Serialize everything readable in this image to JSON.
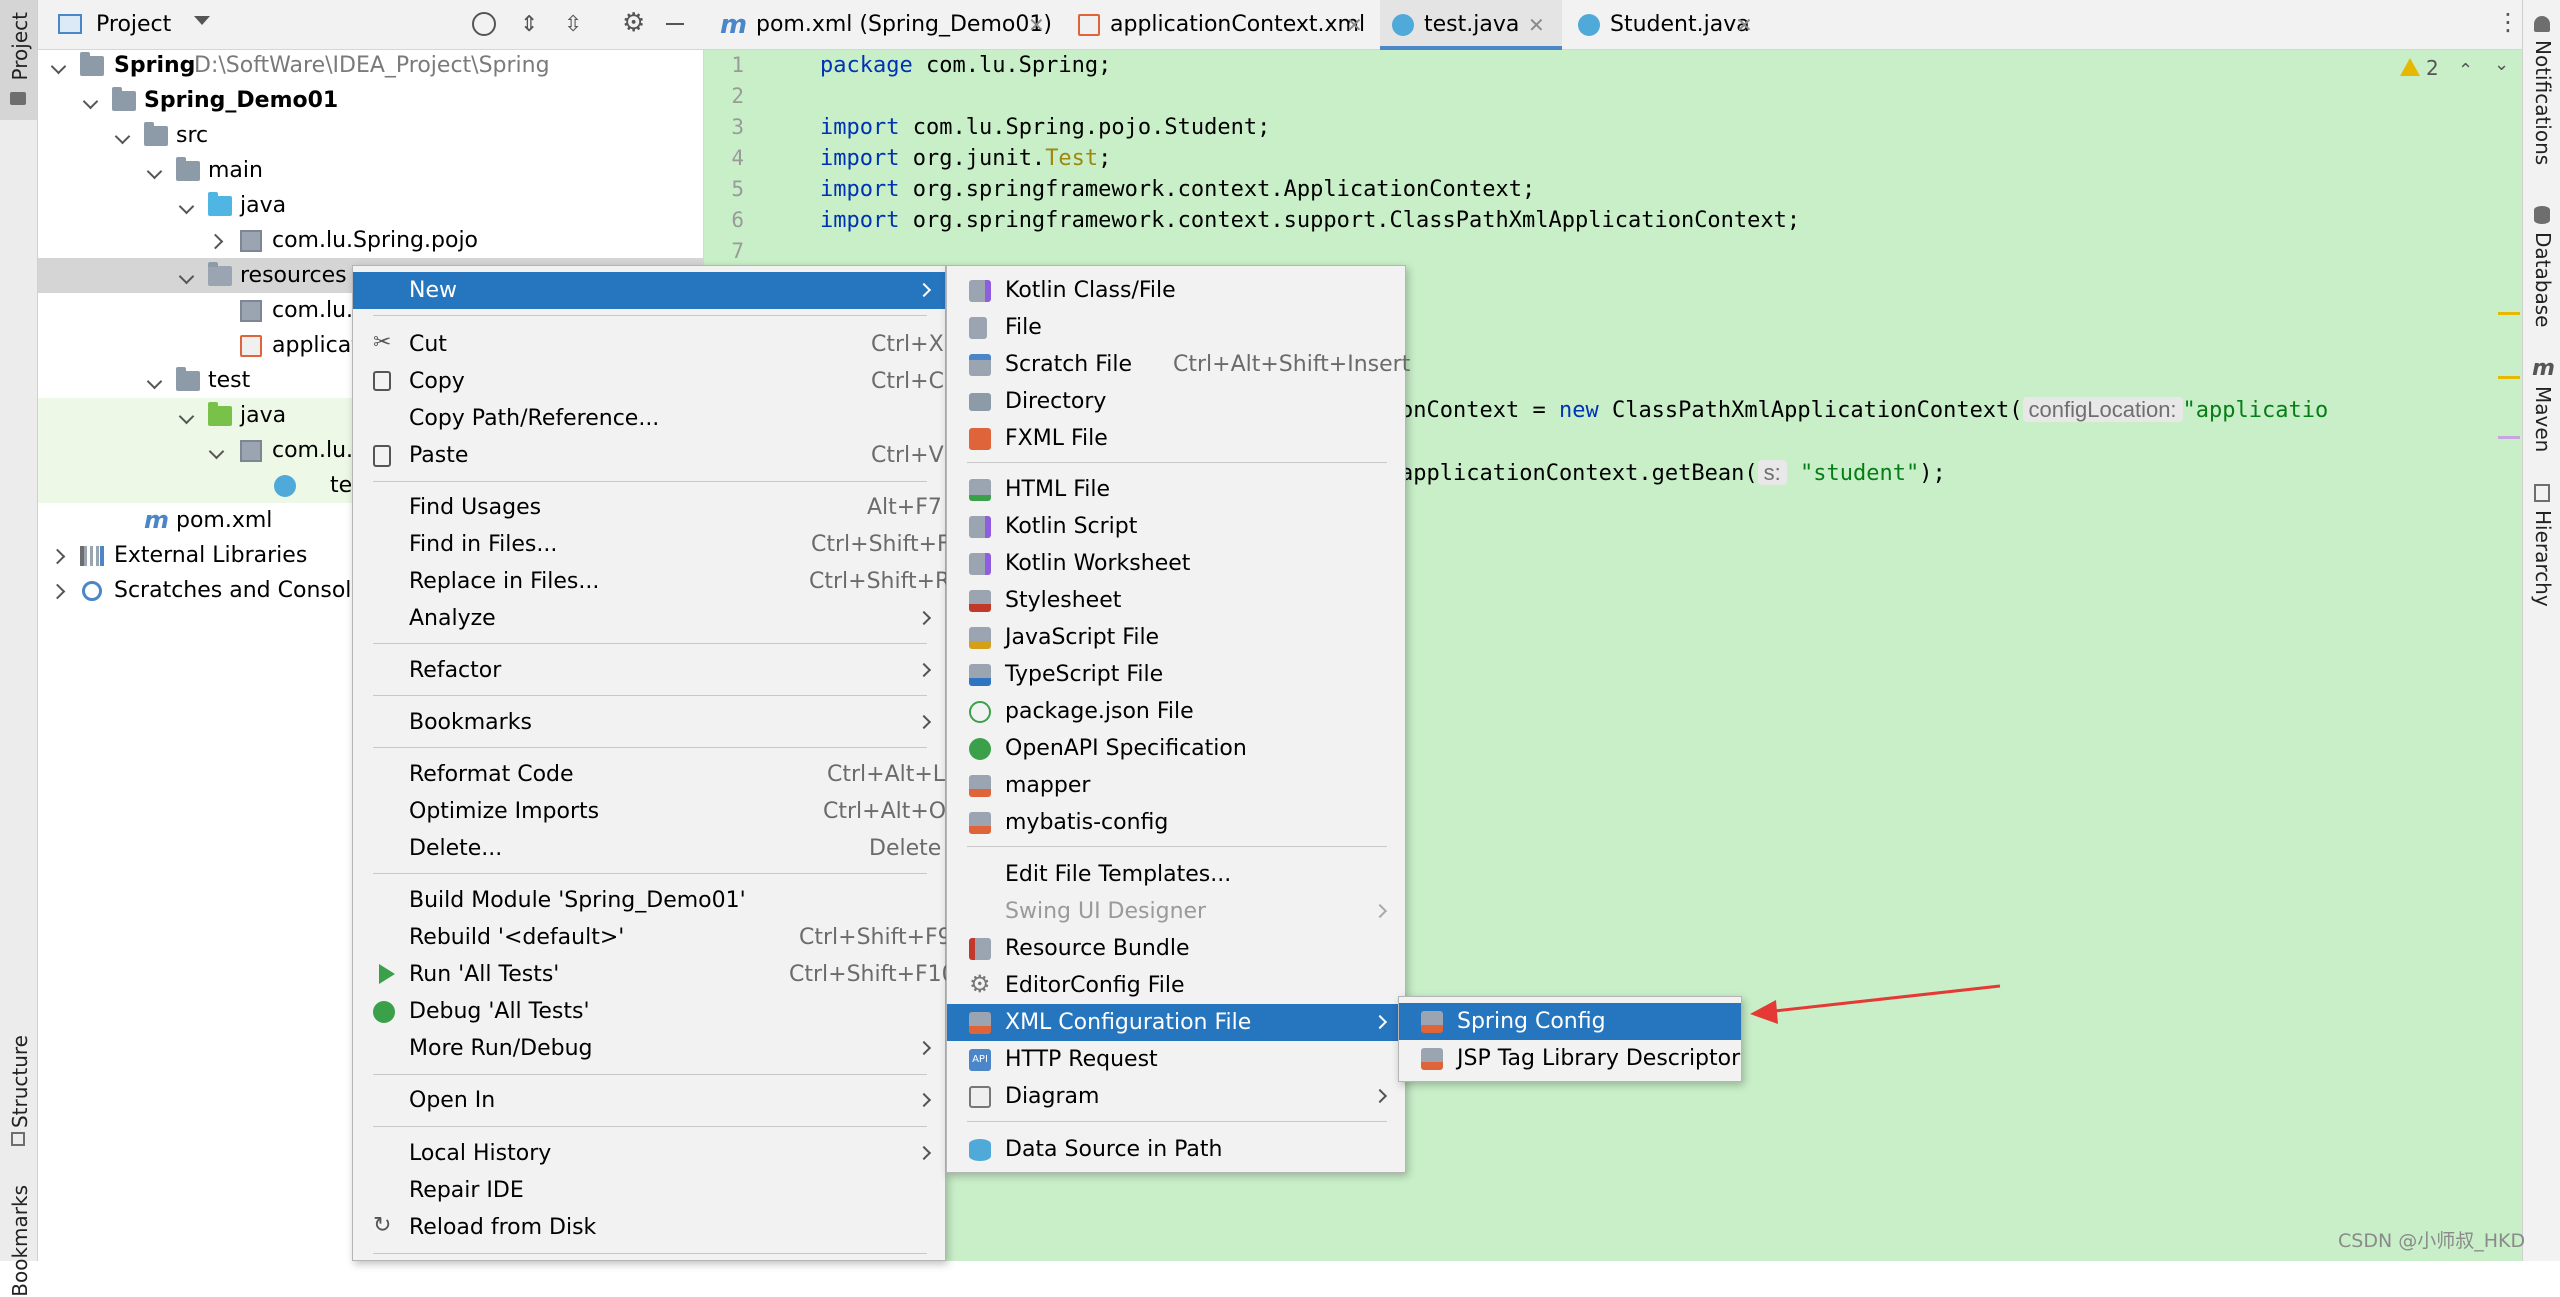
{
  "left_strip": {
    "project": "Project",
    "structure": "Structure",
    "bookmarks": "Bookmarks"
  },
  "right_strip": {
    "notifications": "Notifications",
    "database": "Database",
    "maven": "Maven",
    "hierarchy": "Hierarchy"
  },
  "project_header": {
    "title": "Project"
  },
  "tree": {
    "spring": "Spring",
    "spring_path": "D:\\SoftWare\\IDEA_Project\\Spring",
    "demo": "Spring_Demo01",
    "src": "src",
    "main": "main",
    "java": "java",
    "pojo": "com.lu.Spring.pojo",
    "resources": "resources",
    "res_pkg": "com.lu.S",
    "app": "applicat",
    "test": "test",
    "test_java": "java",
    "test_pkg": "com.lu.S",
    "test_file": "te",
    "pom": "pom.xml",
    "ext": "External Libraries",
    "scratch": "Scratches and Consoles"
  },
  "tabs": [
    {
      "label": "pom.xml (Spring_Demo01)"
    },
    {
      "label": "applicationContext.xml"
    },
    {
      "label": "test.java"
    },
    {
      "label": "Student.java"
    }
  ],
  "editor": {
    "warnings": "2",
    "lines": [
      "1",
      "2",
      "3",
      "4",
      "5",
      "6",
      "7"
    ],
    "code": {
      "l1_kw": "package",
      "l1_rest": " com.lu.Spring;",
      "l3_kw": "import",
      "l3_rest": " com.lu.Spring.pojo.Student;",
      "l4_kw": "import",
      "l4_pre": " org.junit.",
      "l4_ann": "Test",
      "l4_end": ";",
      "l5_kw": "import",
      "l5_rest": " org.springframework.context.ApplicationContext;",
      "l6_kw": "import",
      "l6_rest": " org.springframework.context.support.ClassPathXmlApplicationContext;",
      "l10_pre": "onContext = ",
      "l10_kw": "new",
      "l10_mid": " ClassPathXmlApplicationContext(",
      "l10_hint": "configLocation:",
      "l10_str": "\"applicatio",
      "l12_pre": "applicationContext.getBean(",
      "l12_hint": "s:",
      "l12_str": "\"student\"",
      "l12_end": ");"
    }
  },
  "context_menu": {
    "new": "New",
    "cut": "Cut",
    "cut_sc": "Ctrl+X",
    "copy": "Copy",
    "copy_sc": "Ctrl+C",
    "copy_path": "Copy Path/Reference...",
    "paste": "Paste",
    "paste_sc": "Ctrl+V",
    "find_usages": "Find Usages",
    "find_usages_sc": "Alt+F7",
    "find_in_files": "Find in Files...",
    "find_in_files_sc": "Ctrl+Shift+F",
    "replace_in_files": "Replace in Files...",
    "replace_in_files_sc": "Ctrl+Shift+R",
    "analyze": "Analyze",
    "refactor": "Refactor",
    "bookmarks": "Bookmarks",
    "reformat": "Reformat Code",
    "reformat_sc": "Ctrl+Alt+L",
    "optimize": "Optimize Imports",
    "optimize_sc": "Ctrl+Alt+O",
    "delete": "Delete...",
    "delete_sc": "Delete",
    "build_module": "Build Module 'Spring_Demo01'",
    "rebuild": "Rebuild '<default>'",
    "rebuild_sc": "Ctrl+Shift+F9",
    "run": "Run 'All Tests'",
    "run_sc": "Ctrl+Shift+F10",
    "debug": "Debug 'All Tests'",
    "more_run": "More Run/Debug",
    "open_in": "Open In",
    "local_history": "Local History",
    "repair": "Repair IDE",
    "reload": "Reload from Disk"
  },
  "new_menu": {
    "kotlin_class": "Kotlin Class/File",
    "file": "File",
    "scratch": "Scratch File",
    "scratch_sc": "Ctrl+Alt+Shift+Insert",
    "directory": "Directory",
    "fxml": "FXML File",
    "html": "HTML File",
    "kotlin_script": "Kotlin Script",
    "kotlin_worksheet": "Kotlin Worksheet",
    "stylesheet": "Stylesheet",
    "js": "JavaScript File",
    "ts": "TypeScript File",
    "packagejson": "package.json File",
    "openapi": "OpenAPI Specification",
    "mapper": "mapper",
    "mybatis": "mybatis-config",
    "edit_templates": "Edit File Templates...",
    "swing": "Swing UI Designer",
    "resource_bundle": "Resource Bundle",
    "editorconfig": "EditorConfig File",
    "xml_config": "XML Configuration File",
    "http": "HTTP Request",
    "diagram": "Diagram",
    "datasource": "Data Source in Path"
  },
  "xml_menu": {
    "spring_config": "Spring Config",
    "jsp_tld": "JSP Tag Library Descriptor"
  },
  "watermark": "CSDN @小师叔_HKD",
  "colors": {
    "selection": "#2675bf",
    "editor_bg": "#c9efc9",
    "arrow": "#e53935"
  }
}
